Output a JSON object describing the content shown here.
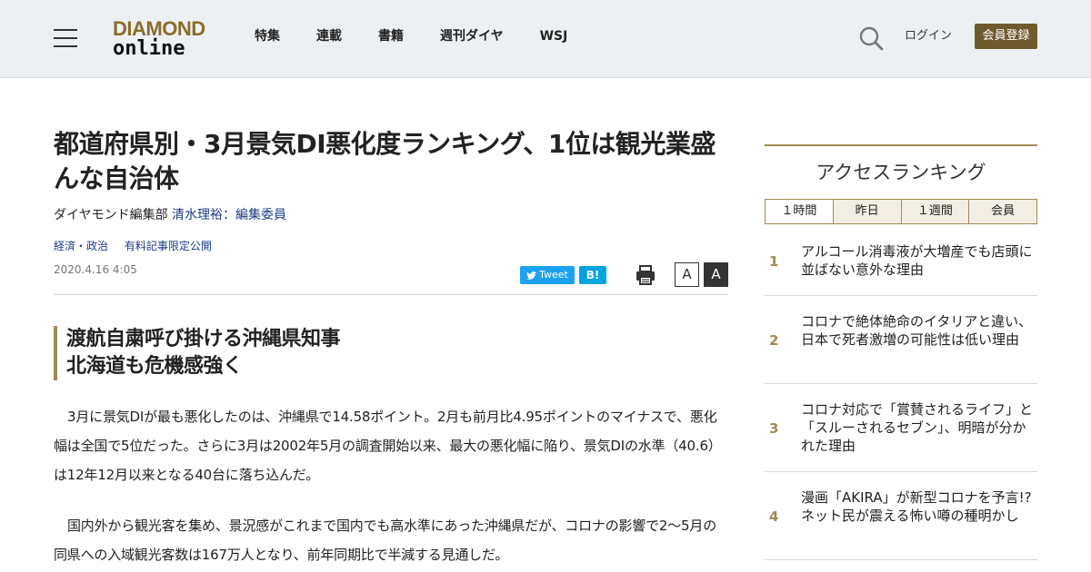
{
  "header": {
    "logo_line1": "DIAMOND",
    "logo_line2": "online",
    "nav": [
      "特集",
      "連載",
      "書籍",
      "週刊ダイヤ",
      "WSJ"
    ],
    "login": "ログイン",
    "register": "会員登録"
  },
  "article": {
    "title": "都道府県別・3月景気DI悪化度ランキング、1位は観光業盛んな自治体",
    "byline_prefix": "ダイヤモンド編集部",
    "author": "清水理裕：編集委員",
    "tags": [
      "経済・政治",
      "有料記事限定公開"
    ],
    "date": "2020.4.16 4:05",
    "share": {
      "tweet": "Tweet",
      "hatena": "B!",
      "font_small": "A",
      "font_large": "A"
    },
    "subheading_lines": [
      "渡航自粛呼び掛ける沖縄県知事",
      "北海道も危機感強く"
    ],
    "paragraphs": [
      "3月に景気DIが最も悪化したのは、沖縄県で14.58ポイント。2月も前月比4.95ポイントのマイナスで、悪化幅は全国で5位だった。さらに3月は2002年5月の調査開始以来、最大の悪化幅に陥り、景気DIの水準（40.6）は12年12月以来となる40台に落ち込んだ。",
      "国内外から観光客を集め、景況感がこれまで国内でも高水準にあった沖縄県だが、コロナの影響で2〜5月の同県への入域観光客数は167万人となり、前年同期比で半減する見通しだ。"
    ]
  },
  "ranking": {
    "title": "アクセスランキング",
    "tabs": [
      "１時間",
      "昨日",
      "１週間",
      "会員"
    ],
    "items": [
      {
        "rank": "1",
        "text": "アルコール消毒液が大増産でも店頭に並ばない意外な理由"
      },
      {
        "rank": "2",
        "text": "コロナで絶体絶命のイタリアと違い、日本で死者激増の可能性は低い理由"
      },
      {
        "rank": "3",
        "text": "コロナ対応で「賞賛されるライフ」と「スルーされるセブン」、明暗が分かれた理由"
      },
      {
        "rank": "4",
        "text": "漫画「AKIRA」が新型コロナを予言!?ネット民が震える怖い噂の種明かし"
      }
    ]
  },
  "colors": {
    "header_bg": "#edf0f3",
    "accent": "#a08a52",
    "register_bg": "#6f5a2e",
    "link": "#1b3b86",
    "tweet": "#1da1f2",
    "hatena": "#00a4de"
  },
  "icons": {
    "menu": "hamburger-icon",
    "search": "search-icon",
    "print": "print-icon",
    "tweet": "twitter-bird-icon"
  }
}
